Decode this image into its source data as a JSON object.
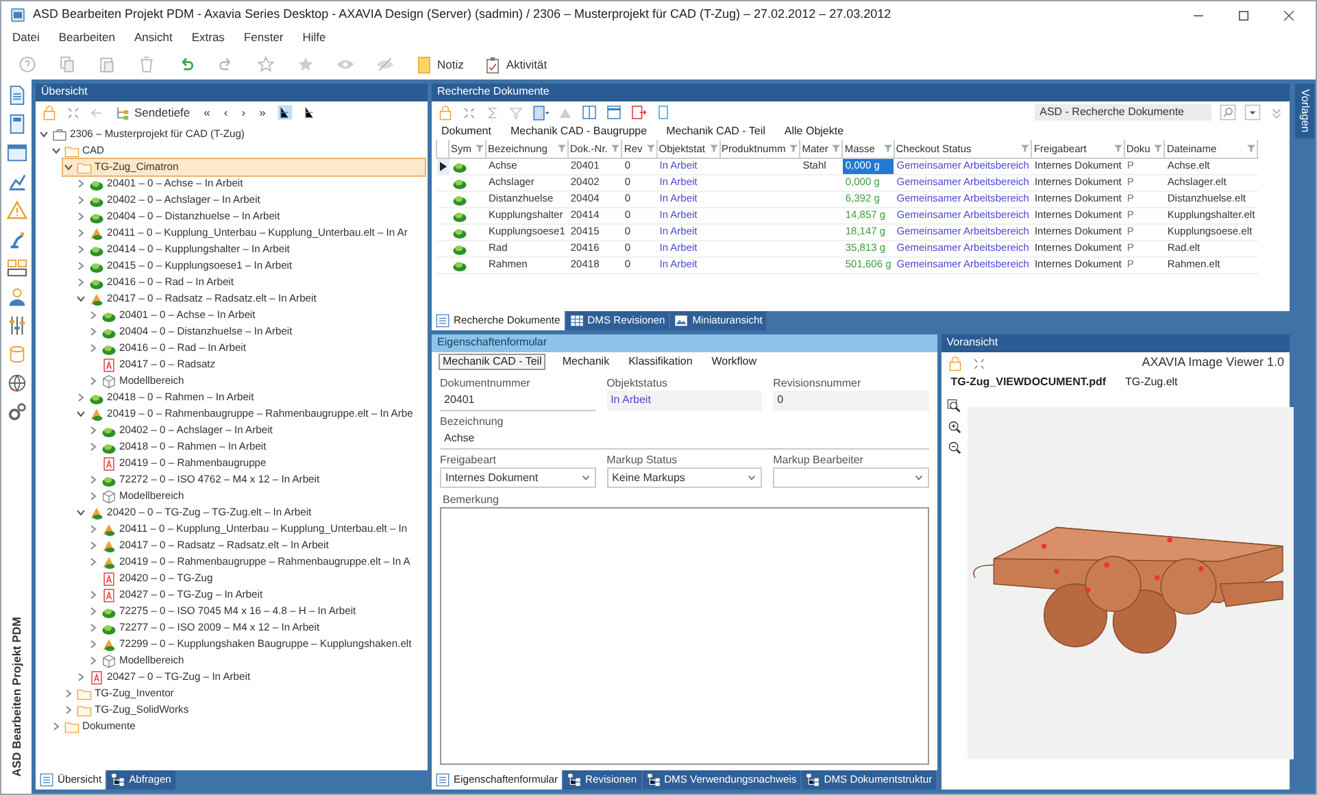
{
  "window": {
    "title": "ASD Bearbeiten Projekt PDM - Axavia Series Desktop - AXAVIA Design (Server) (sadmin) / 2306 – Musterprojekt für CAD (T-Zug) – 27.02.2012 – 27.03.2012"
  },
  "menu": [
    "Datei",
    "Bearbeiten",
    "Ansicht",
    "Extras",
    "Fenster",
    "Hilfe"
  ],
  "toolbar": {
    "buttons": [
      "Notiz",
      "Aktivität"
    ]
  },
  "sidebar": {
    "caption": "ASD Bearbeiten Projekt PDM"
  },
  "overview": {
    "title": "Übersicht",
    "depth_button": "Sendetiefe",
    "nav": [
      "«",
      "‹",
      "›",
      "»"
    ],
    "tree": [
      {
        "label": "2306 – Musterprojekt für CAD (T-Zug)",
        "kind": "project",
        "expanded": true,
        "selected": false,
        "children": [
          {
            "label": "CAD",
            "kind": "folder",
            "expanded": true,
            "selected": false,
            "children": [
              {
                "label": "TG-Zug_Cimatron",
                "kind": "folder",
                "expanded": true,
                "selected": true,
                "children": [
                  {
                    "label": "20401 – 0 – Achse – In Arbeit",
                    "kind": "part",
                    "expanded": false,
                    "selected": false
                  },
                  {
                    "label": "20402 – 0 – Achslager – In Arbeit",
                    "kind": "part",
                    "expanded": false,
                    "selected": false
                  },
                  {
                    "label": "20404 – 0 – Distanzhuelse – In Arbeit",
                    "kind": "part",
                    "expanded": false,
                    "selected": false
                  },
                  {
                    "label": "20411 – 0 – Kupplung_Unterbau – Kupplung_Unterbau.elt – In Ar",
                    "kind": "assembly",
                    "expanded": false,
                    "selected": false
                  },
                  {
                    "label": "20414 – 0 – Kupplungshalter – In Arbeit",
                    "kind": "part",
                    "expanded": false,
                    "selected": false
                  },
                  {
                    "label": "20415 – 0 – Kupplungsoese1 – In Arbeit",
                    "kind": "part",
                    "expanded": false,
                    "selected": false
                  },
                  {
                    "label": "20416 – 0 – Rad – In Arbeit",
                    "kind": "part",
                    "expanded": false,
                    "selected": false
                  },
                  {
                    "label": "20417 – 0 – Radsatz – Radsatz.elt – In Arbeit",
                    "kind": "assembly",
                    "expanded": true,
                    "selected": false,
                    "children": [
                      {
                        "label": "20401 – 0 – Achse – In Arbeit",
                        "kind": "part",
                        "expanded": false,
                        "selected": false
                      },
                      {
                        "label": "20404 – 0 – Distanzhuelse – In Arbeit",
                        "kind": "part",
                        "expanded": false,
                        "selected": false
                      },
                      {
                        "label": "20416 – 0 – Rad – In Arbeit",
                        "kind": "part",
                        "expanded": false,
                        "selected": false
                      },
                      {
                        "label": "20417 – 0 – Radsatz",
                        "kind": "pdf",
                        "selected": false
                      },
                      {
                        "label": "Modellbereich",
                        "kind": "model",
                        "expanded": false,
                        "selected": false
                      }
                    ]
                  },
                  {
                    "label": "20418 – 0 – Rahmen – In Arbeit",
                    "kind": "part",
                    "expanded": false,
                    "selected": false
                  },
                  {
                    "label": "20419 – 0 – Rahmenbaugruppe – Rahmenbaugruppe.elt – In Arbe",
                    "kind": "assembly",
                    "expanded": true,
                    "selected": false,
                    "children": [
                      {
                        "label": "20402 – 0 – Achslager – In Arbeit",
                        "kind": "part",
                        "expanded": false,
                        "selected": false
                      },
                      {
                        "label": "20418 – 0 – Rahmen – In Arbeit",
                        "kind": "part",
                        "expanded": false,
                        "selected": false
                      },
                      {
                        "label": "20419 – 0 – Rahmenbaugruppe",
                        "kind": "pdf",
                        "selected": false
                      },
                      {
                        "label": "72272 – 0 – ISO 4762 – M4 x 12 – In Arbeit",
                        "kind": "part",
                        "expanded": false,
                        "selected": false
                      },
                      {
                        "label": "Modellbereich",
                        "kind": "model",
                        "expanded": false,
                        "selected": false
                      }
                    ]
                  },
                  {
                    "label": "20420 – 0 – TG-Zug – TG-Zug.elt – In Arbeit",
                    "kind": "assembly",
                    "expanded": true,
                    "selected": false,
                    "children": [
                      {
                        "label": "20411 – 0 – Kupplung_Unterbau – Kupplung_Unterbau.elt – In",
                        "kind": "assembly",
                        "expanded": false,
                        "selected": false
                      },
                      {
                        "label": "20417 – 0 – Radsatz – Radsatz.elt – In Arbeit",
                        "kind": "assembly",
                        "expanded": false,
                        "selected": false
                      },
                      {
                        "label": "20419 – 0 – Rahmenbaugruppe – Rahmenbaugruppe.elt – In A",
                        "kind": "assembly",
                        "expanded": false,
                        "selected": false
                      },
                      {
                        "label": "20420 – 0 – TG-Zug",
                        "kind": "pdf",
                        "selected": false
                      },
                      {
                        "label": "20427 – 0 – TG-Zug – In Arbeit",
                        "kind": "pdf",
                        "expanded": false,
                        "selected": false
                      },
                      {
                        "label": "72275 – 0 – ISO 7045 M4 x 16 – 4.8 – H – In Arbeit",
                        "kind": "part",
                        "expanded": false,
                        "selected": false
                      },
                      {
                        "label": "72277 – 0 – ISO 2009 – M4 x 12 – In Arbeit",
                        "kind": "part",
                        "expanded": false,
                        "selected": false
                      },
                      {
                        "label": "72299 – 0 – Kupplungshaken Baugruppe – Kupplungshaken.elt",
                        "kind": "assembly",
                        "expanded": false,
                        "selected": false
                      },
                      {
                        "label": "Modellbereich",
                        "kind": "model",
                        "expanded": false,
                        "selected": false
                      }
                    ]
                  },
                  {
                    "label": "20427 – 0 – TG-Zug – In Arbeit",
                    "kind": "pdf",
                    "expanded": false,
                    "selected": false
                  }
                ]
              },
              {
                "label": "TG-Zug_Inventor",
                "kind": "folder",
                "expanded": false,
                "selected": false
              },
              {
                "label": "TG-Zug_SolidWorks",
                "kind": "folder",
                "expanded": false,
                "selected": false
              }
            ]
          },
          {
            "label": "Dokumente",
            "kind": "folder",
            "expanded": false,
            "selected": false
          }
        ]
      }
    ],
    "tabs": [
      {
        "label": "Übersicht",
        "selected": true
      },
      {
        "label": "Abfragen",
        "selected": false
      }
    ]
  },
  "search_results": {
    "title": "Recherche Dokumente",
    "view": "ASD - Recherche Dokumente",
    "filters": [
      "Dokument",
      "Mechanik CAD - Baugruppe",
      "Mechanik CAD - Teil",
      "Alle Objekte"
    ],
    "columns": [
      "Sym",
      "Bezeichnung",
      "Dok.-Nr.",
      "Rev",
      "Objektstat",
      "Produktnumm",
      "Mater",
      "Masse",
      "Checkout Status",
      "Freigabeart",
      "Doku",
      "Dateiname"
    ],
    "rows": [
      {
        "selected": true,
        "bezeichnung": "Achse",
        "dok_nr": "20401",
        "rev": "0",
        "objektstatus": "In Arbeit",
        "material": "Stahl",
        "masse": "0,000 g",
        "checkout": "Gemeinsamer Arbeitsbereich",
        "freigabeart": "Internes Dokument",
        "doku": "P",
        "dateiname": "Achse.elt"
      },
      {
        "selected": false,
        "bezeichnung": "Achslager",
        "dok_nr": "20402",
        "rev": "0",
        "objektstatus": "In Arbeit",
        "masse": "0,000 g",
        "checkout": "Gemeinsamer Arbeitsbereich",
        "freigabeart": "Internes Dokument",
        "doku": "P",
        "dateiname": "Achslager.elt"
      },
      {
        "selected": false,
        "bezeichnung": "Distanzhuelse",
        "dok_nr": "20404",
        "rev": "0",
        "objektstatus": "In Arbeit",
        "masse": "6,392 g",
        "checkout": "Gemeinsamer Arbeitsbereich",
        "freigabeart": "Internes Dokument",
        "doku": "P",
        "dateiname": "Distanzhuelse.elt"
      },
      {
        "selected": false,
        "bezeichnung": "Kupplungshalter",
        "dok_nr": "20414",
        "rev": "0",
        "objektstatus": "In Arbeit",
        "masse": "14,857 g",
        "checkout": "Gemeinsamer Arbeitsbereich",
        "freigabeart": "Internes Dokument",
        "doku": "P",
        "dateiname": "Kupplungshalter.elt"
      },
      {
        "selected": false,
        "bezeichnung": "Kupplungsoese1",
        "dok_nr": "20415",
        "rev": "0",
        "objektstatus": "In Arbeit",
        "masse": "18,147 g",
        "checkout": "Gemeinsamer Arbeitsbereich",
        "freigabeart": "Internes Dokument",
        "doku": "P",
        "dateiname": "Kupplungsoese.elt"
      },
      {
        "selected": false,
        "bezeichnung": "Rad",
        "dok_nr": "20416",
        "rev": "0",
        "objektstatus": "In Arbeit",
        "masse": "35,813 g",
        "checkout": "Gemeinsamer Arbeitsbereich",
        "freigabeart": "Internes Dokument",
        "doku": "P",
        "dateiname": "Rad.elt"
      },
      {
        "selected": false,
        "bezeichnung": "Rahmen",
        "dok_nr": "20418",
        "rev": "0",
        "objektstatus": "In Arbeit",
        "masse": "501,606 g",
        "checkout": "Gemeinsamer Arbeitsbereich",
        "freigabeart": "Internes Dokument",
        "doku": "P",
        "dateiname": "Rahmen.elt"
      }
    ],
    "tabs": [
      {
        "label": "Recherche Dokumente",
        "selected": true
      },
      {
        "label": "DMS Revisionen",
        "selected": false
      },
      {
        "label": "Miniaturansicht",
        "selected": false
      }
    ]
  },
  "properties": {
    "title": "Eigenschaftenformular",
    "form_tabs": [
      {
        "label": "Mechanik CAD - Teil",
        "selected": true
      },
      {
        "label": "Mechanik",
        "selected": false
      },
      {
        "label": "Klassifikation",
        "selected": false
      },
      {
        "label": "Workflow",
        "selected": false
      }
    ],
    "fields": [
      {
        "label": "Dokumentnummer",
        "value": "20401",
        "kind": "text"
      },
      {
        "label": "Objektstatus",
        "value": "In Arbeit",
        "kind": "status"
      },
      {
        "label": "Revisionsnummer",
        "value": "0",
        "kind": "readonly"
      },
      {
        "label": "Bezeichnung",
        "value": "Achse",
        "kind": "wide"
      },
      {
        "label": "Freigabeart",
        "value": "Internes Dokument",
        "kind": "select"
      },
      {
        "label": "Markup Status",
        "value": "Keine Markups",
        "kind": "select"
      },
      {
        "label": "Markup Bearbeiter",
        "kind": "select"
      },
      {
        "label": "Bemerkung",
        "kind": "textarea"
      }
    ],
    "tabs": [
      {
        "label": "Eigenschaftenformular",
        "selected": true
      },
      {
        "label": "Revisionen",
        "selected": false
      },
      {
        "label": "DMS Verwendungsnachweis",
        "selected": false
      },
      {
        "label": "DMS Dokumentstruktur",
        "selected": false
      }
    ]
  },
  "preview": {
    "title": "Voransicht",
    "viewer": "AXAVIA Image Viewer 1.0",
    "files": [
      {
        "label": "TG-Zug_VIEWDOCUMENT.pdf",
        "selected": true
      },
      {
        "label": "TG-Zug.elt",
        "selected": false
      }
    ]
  },
  "right_panel": {
    "label": "Vorlagen"
  }
}
